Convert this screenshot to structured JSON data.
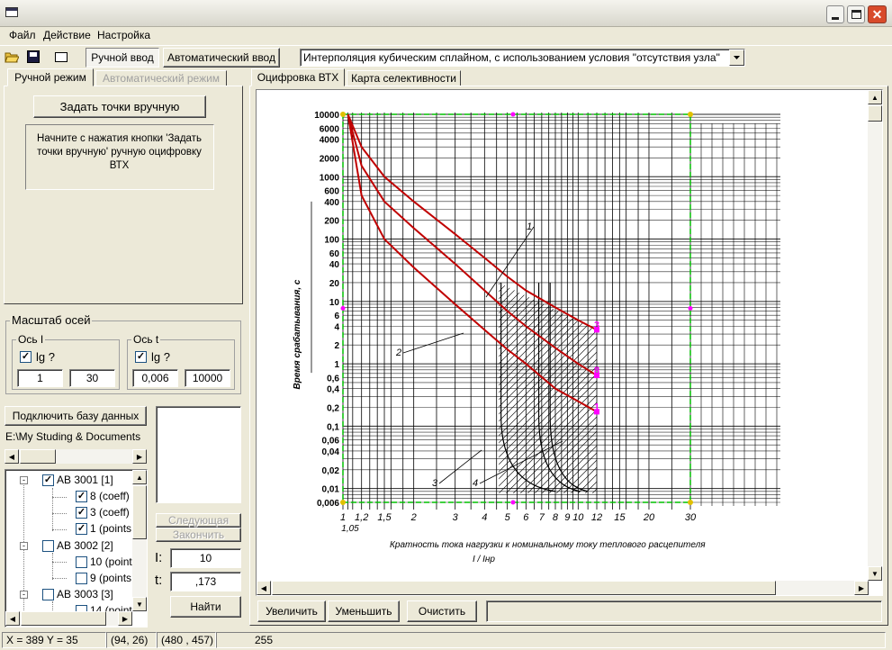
{
  "menu": {
    "file": "Файл",
    "action": "Действие",
    "settings": "Настройка"
  },
  "toolbar": {
    "manual_input": "Ручной ввод",
    "auto_input": "Автоматический ввод",
    "interp_value": "Интерполяция кубическим сплайном, с использованием условия \"отсутствия узла\""
  },
  "left_tabs": {
    "manual": "Ручной режим",
    "auto": "Автоматический режим"
  },
  "manual_panel": {
    "set_points_button": "Задать точки вручную",
    "hint": "Начните с нажатия кнопки 'Задать точки вручную' ручную оцифровку ВТХ"
  },
  "axes_scale": {
    "title": "Масштаб осей",
    "axis_i": {
      "title": "Ось I",
      "lg_label": "lg ?",
      "lg_checked": true,
      "min": "1",
      "max": "30"
    },
    "axis_t": {
      "title": "Ось t",
      "lg_label": "lg ?",
      "lg_checked": true,
      "min": "0,006",
      "max": "10000"
    }
  },
  "db": {
    "connect_button": "Подключить базу данных",
    "path": "E:\\My Studing & Documents"
  },
  "tree": [
    {
      "label": "АВ 3001 [1]",
      "checked": true,
      "children": [
        {
          "label": "8 (coeff)",
          "checked": true
        },
        {
          "label": "3 (coeff)",
          "checked": true
        },
        {
          "label": "1 (points",
          "checked": true
        }
      ]
    },
    {
      "label": "АВ 3002 [2]",
      "checked": false,
      "children": [
        {
          "label": "10 (point",
          "checked": false
        },
        {
          "label": "9 (points",
          "checked": false
        }
      ]
    },
    {
      "label": "АВ 3003 [3]",
      "checked": false,
      "children": [
        {
          "label": "14 (point",
          "checked": false
        }
      ]
    }
  ],
  "right_controls": {
    "next": "Следующая",
    "finish": "Закончить",
    "i_label": "I:",
    "i_value": "10",
    "t_label": "t:",
    "t_value": ",173",
    "find": "Найти"
  },
  "main_tabs": {
    "digitize": "Оцифровка ВТХ",
    "selectivity": "Карта селективности"
  },
  "bottom_buttons": {
    "zoom_in": "Увеличить",
    "zoom_out": "Уменьшить",
    "clear": "Очистить"
  },
  "status": {
    "coords": "X = 389  Y = 35",
    "px1": "(94, 26)",
    "px2": "(480 , 457)",
    "value": "255"
  },
  "chart_data": {
    "type": "line",
    "ylabel": "Время срабатывания, с",
    "xlabel": "Кратность тока нагрузки к номинальному току теплового расцепителя",
    "xlabel_frac": "I / Iнр",
    "x_ticks": [
      "1",
      "1,2",
      "1,5",
      "2",
      "3",
      "4",
      "5",
      "6",
      "7",
      "8",
      "9",
      "10",
      "12",
      "15",
      "20",
      "30"
    ],
    "x_sub": "1,05",
    "y_ticks": [
      "10000",
      "6000",
      "4000",
      "2000",
      "1000",
      "600",
      "400",
      "200",
      "100",
      "60",
      "40",
      "20",
      "10",
      "6",
      "4",
      "2",
      "1",
      "0,6",
      "0,4",
      "0,2",
      "0,1",
      "0,06",
      "0,04",
      "0,02",
      "0,01",
      "0,006"
    ],
    "xlim": [
      1,
      30
    ],
    "ylim": [
      0.006,
      10000
    ],
    "log_x": true,
    "log_y": true,
    "curve_labels": [
      "1",
      "2",
      "3",
      "4"
    ],
    "marker_labels": [
      "3",
      "8",
      "1"
    ],
    "series": [
      {
        "name": "8",
        "x": [
          1.05,
          1.2,
          1.5,
          2,
          3,
          4,
          5,
          6,
          8,
          10,
          12
        ],
        "y": [
          10000,
          3000,
          1000,
          400,
          120,
          50,
          25,
          15,
          8,
          5,
          3.5
        ]
      },
      {
        "name": "3",
        "x": [
          1.05,
          1.2,
          1.5,
          2,
          3,
          4,
          5,
          6,
          8,
          10,
          12
        ],
        "y": [
          10000,
          1500,
          400,
          150,
          40,
          15,
          7,
          4,
          1.8,
          1,
          0.65
        ]
      },
      {
        "name": "1",
        "x": [
          1.05,
          1.2,
          1.5,
          2,
          3,
          4,
          5,
          6,
          8,
          10,
          12
        ],
        "y": [
          10000,
          500,
          100,
          35,
          9,
          3.5,
          1.7,
          1,
          0.4,
          0.25,
          0.17
        ]
      }
    ],
    "colors": {
      "curve": "#c00000",
      "border": "#00c000",
      "marker": "#ff00ff",
      "corner": "#e0c000"
    }
  }
}
